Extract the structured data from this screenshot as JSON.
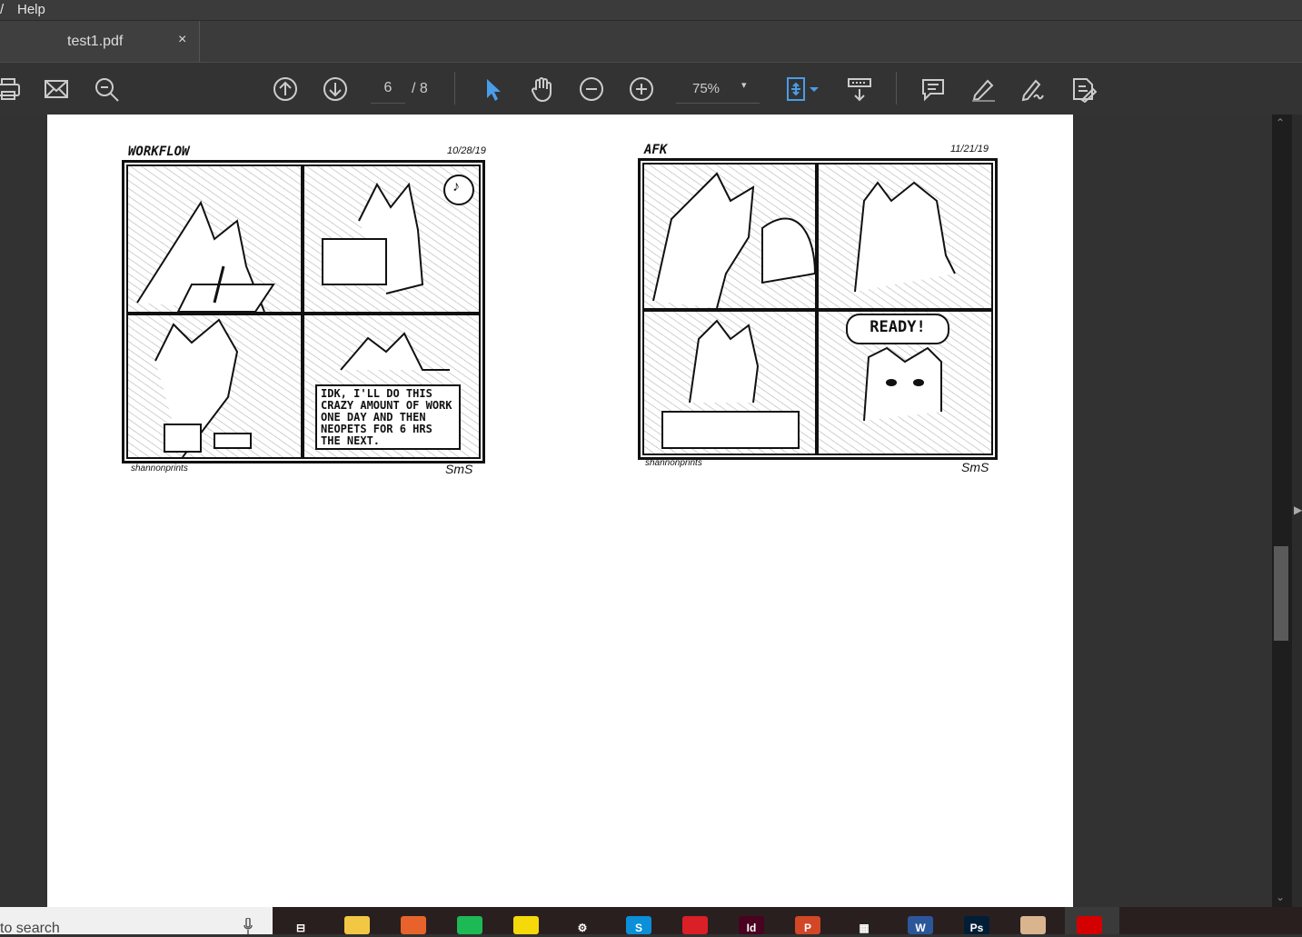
{
  "menubar": {
    "partial_item": "/",
    "help_label": "Help"
  },
  "tab": {
    "title": "test1.pdf",
    "close_label": "×"
  },
  "toolbar": {
    "page_current": "6",
    "page_total": "/ 8",
    "zoom_value": "75%",
    "zoom_arrow": "▾",
    "icons": [
      "print-icon",
      "mail-icon",
      "zoom-search-icon",
      "prev-page-icon",
      "next-page-icon",
      "select-cursor-icon",
      "hand-tool-icon",
      "zoom-out-icon",
      "zoom-in-icon",
      "fit-page-icon",
      "scroll-mode-icon",
      "comment-icon",
      "highlight-pen-icon",
      "sign-icon",
      "fill-sign-icon"
    ],
    "accent_color": "#4a9de8"
  },
  "document": {
    "comic1": {
      "title": "WORKFLOW",
      "date": "10/28/19",
      "credit": "shannonprints",
      "signature": "SmS",
      "music_note": "♪",
      "speech": "IDK, I'LL DO THIS CRAZY AMOUNT OF WORK ONE DAY AND THEN NEOPETS FOR 6 HRS THE NEXT."
    },
    "comic2": {
      "title": "AFK",
      "date": "11/21/19",
      "credit": "shannonprints",
      "signature": "SmS",
      "speech": "READY!"
    }
  },
  "scrollbar": {
    "up": "⌃",
    "down": "⌄"
  },
  "taskbar": {
    "search_placeholder": "to search",
    "apps": [
      {
        "name": "task-view-icon",
        "label": "⊟",
        "color": "#2a1f1f"
      },
      {
        "name": "file-explorer-icon",
        "label": "",
        "color": "#f2c744"
      },
      {
        "name": "firefox-icon",
        "label": "",
        "color": "#e8632b"
      },
      {
        "name": "spotify-icon",
        "label": "",
        "color": "#1db954"
      },
      {
        "name": "sticky-notes-icon",
        "label": "",
        "color": "#f5d90a"
      },
      {
        "name": "settings-icon",
        "label": "⚙",
        "color": "#2a1f1f"
      },
      {
        "name": "skype-icon",
        "label": "S",
        "color": "#0a8fd8"
      },
      {
        "name": "creative-cloud-icon",
        "label": "",
        "color": "#da1f26"
      },
      {
        "name": "indesign-icon",
        "label": "Id",
        "color": "#49021f"
      },
      {
        "name": "powerpoint-icon",
        "label": "P",
        "color": "#d24726"
      },
      {
        "name": "calendar-icon",
        "label": "▦",
        "color": "#2a1f1f"
      },
      {
        "name": "word-icon",
        "label": "W",
        "color": "#2b579a"
      },
      {
        "name": "photoshop-icon",
        "label": "Ps",
        "color": "#001e36"
      },
      {
        "name": "paint-icon",
        "label": "",
        "color": "#d9b48f"
      },
      {
        "name": "acrobat-icon",
        "label": "",
        "color": "#d40000"
      }
    ]
  }
}
